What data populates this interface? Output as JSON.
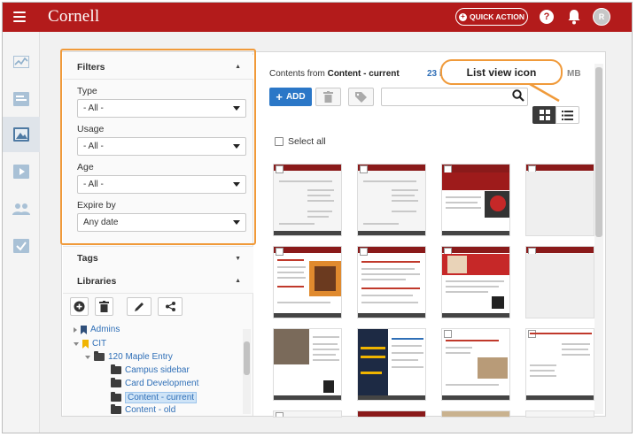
{
  "topbar": {
    "logo": "Cornell",
    "quick_action_label": "QUICK ACTION",
    "help_label": "?",
    "avatar_initial": "R",
    "brand_color": "#b31b1b"
  },
  "rail": {
    "icons": [
      "activity-icon",
      "newsletter-icon",
      "image-library-icon",
      "video-icon",
      "users-icon",
      "checkmark-icon"
    ],
    "active_index": 2
  },
  "filters": {
    "title": "Filters",
    "type_label": "Type",
    "type_value": "- All -",
    "usage_label": "Usage",
    "usage_value": "- All -",
    "age_label": "Age",
    "age_value": "- All -",
    "expire_label": "Expire by",
    "expire_value": "Any date"
  },
  "tags": {
    "title": "Tags"
  },
  "libraries": {
    "title": "Libraries",
    "tree": {
      "admins": "Admins",
      "cit": "CIT",
      "maple": "120 Maple Entry",
      "campus_sidebar": "Campus sidebar",
      "card_dev": "Card Development",
      "content_current": "Content - current",
      "content_old": "Content - old"
    }
  },
  "content": {
    "prefix": "Contents from",
    "folder_name": "Content - current",
    "count": "23 it",
    "size_suffix": "MB",
    "add_label": "ADD",
    "select_all_label": "Select all",
    "search_placeholder": ""
  },
  "callout": {
    "label": "List view icon",
    "accent_color": "#f09a3a"
  }
}
